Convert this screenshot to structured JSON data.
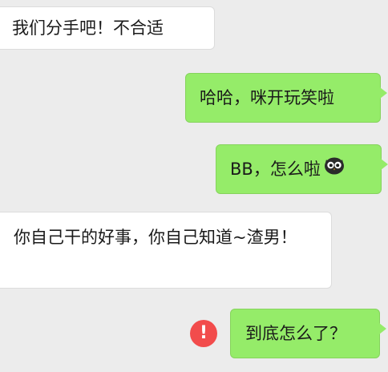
{
  "messages": [
    {
      "id": "msg1",
      "side": "incoming",
      "text": "我们分手吧！不合适"
    },
    {
      "id": "msg2",
      "side": "outgoing",
      "text": "哈哈，咪开玩笑啦"
    },
    {
      "id": "msg3",
      "side": "outgoing",
      "text": "BB，怎么啦",
      "emoji": "owl-emoji"
    },
    {
      "id": "msg4",
      "side": "incoming",
      "text": "你自己干的好事，你自己知道~渣男！"
    },
    {
      "id": "msg5",
      "side": "outgoing",
      "text": "到底怎么了？",
      "status": "send-failed"
    }
  ],
  "status_icon": {
    "symbol": "!",
    "color": "#f24c4c"
  },
  "colors": {
    "background": "#ececec",
    "incoming_bubble": "#ffffff",
    "outgoing_bubble": "#95ec69"
  }
}
